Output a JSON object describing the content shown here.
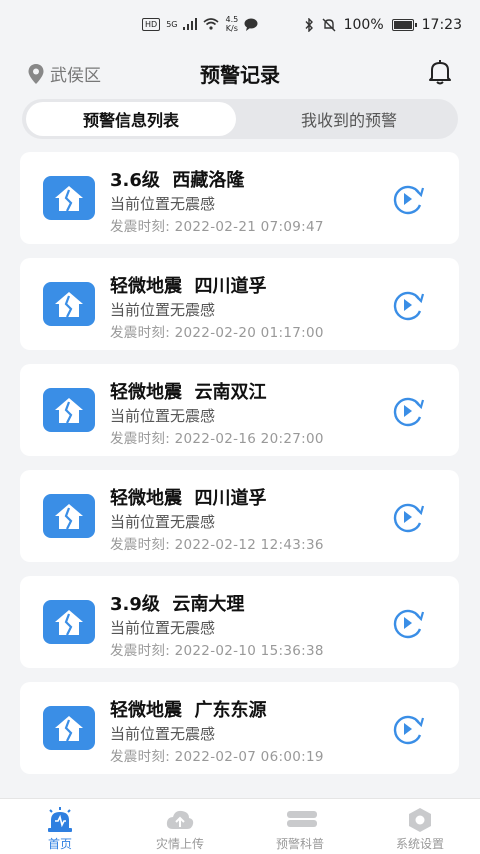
{
  "status_bar": {
    "network": "5G",
    "speed_value": "4.5",
    "speed_unit": "K/s",
    "battery": "100%",
    "time": "17:23"
  },
  "header": {
    "location": "武侯区",
    "title": "预警记录"
  },
  "segment": {
    "tab_list": "预警信息列表",
    "tab_received": "我收到的预警"
  },
  "records": [
    {
      "title": "3.6级  西藏洛隆",
      "status": "当前位置无震感",
      "time": "发震时刻:  2022-02-21 07:09:47"
    },
    {
      "title": "轻微地震  四川道孚",
      "status": "当前位置无震感",
      "time": "发震时刻:  2022-02-20 01:17:00"
    },
    {
      "title": "轻微地震  云南双江",
      "status": "当前位置无震感",
      "time": "发震时刻:  2022-02-16 20:27:00"
    },
    {
      "title": "轻微地震  四川道孚",
      "status": "当前位置无震感",
      "time": "发震时刻:  2022-02-12 12:43:36"
    },
    {
      "title": "3.9级  云南大理",
      "status": "当前位置无震感",
      "time": "发震时刻:  2022-02-10 15:36:38"
    },
    {
      "title": "轻微地震  广东东源",
      "status": "当前位置无震感",
      "time": "发震时刻:  2022-02-07 06:00:19"
    }
  ],
  "tabbar": {
    "home": "首页",
    "upload": "灾情上传",
    "science": "预警科普",
    "settings": "系统设置"
  },
  "colors": {
    "accent": "#3a8ee6",
    "active_tab": "#2f7fe0"
  }
}
